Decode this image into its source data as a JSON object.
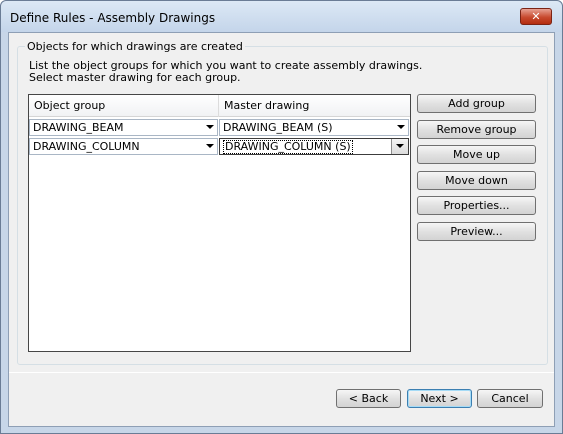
{
  "window": {
    "title": "Define Rules - Assembly Drawings",
    "close_label": "✕"
  },
  "group": {
    "legend": "Objects for which drawings are created",
    "instruction_1": "List the object groups for which you want to create assembly drawings.",
    "instruction_2": "Select master drawing for each group."
  },
  "grid": {
    "columns": [
      "Object group",
      "Master drawing"
    ],
    "rows": [
      {
        "object_group": "DRAWING_BEAM",
        "master_drawing": "DRAWING_BEAM (S)"
      },
      {
        "object_group": "DRAWING_COLUMN",
        "master_drawing": "DRAWING_COLUMN (S)"
      }
    ]
  },
  "side_buttons": {
    "add_group": "Add group",
    "remove_group": "Remove group",
    "move_up": "Move up",
    "move_down": "Move down",
    "properties": "Properties...",
    "preview": "Preview..."
  },
  "footer": {
    "back": "< Back",
    "next": "Next >",
    "cancel": "Cancel"
  },
  "colors": {
    "frame": "#c7d6e8",
    "client": "#f0f0f0",
    "close": "#c84a2f"
  },
  "icons": {
    "close": "close-icon",
    "dropdown": "chevron-down-icon"
  }
}
